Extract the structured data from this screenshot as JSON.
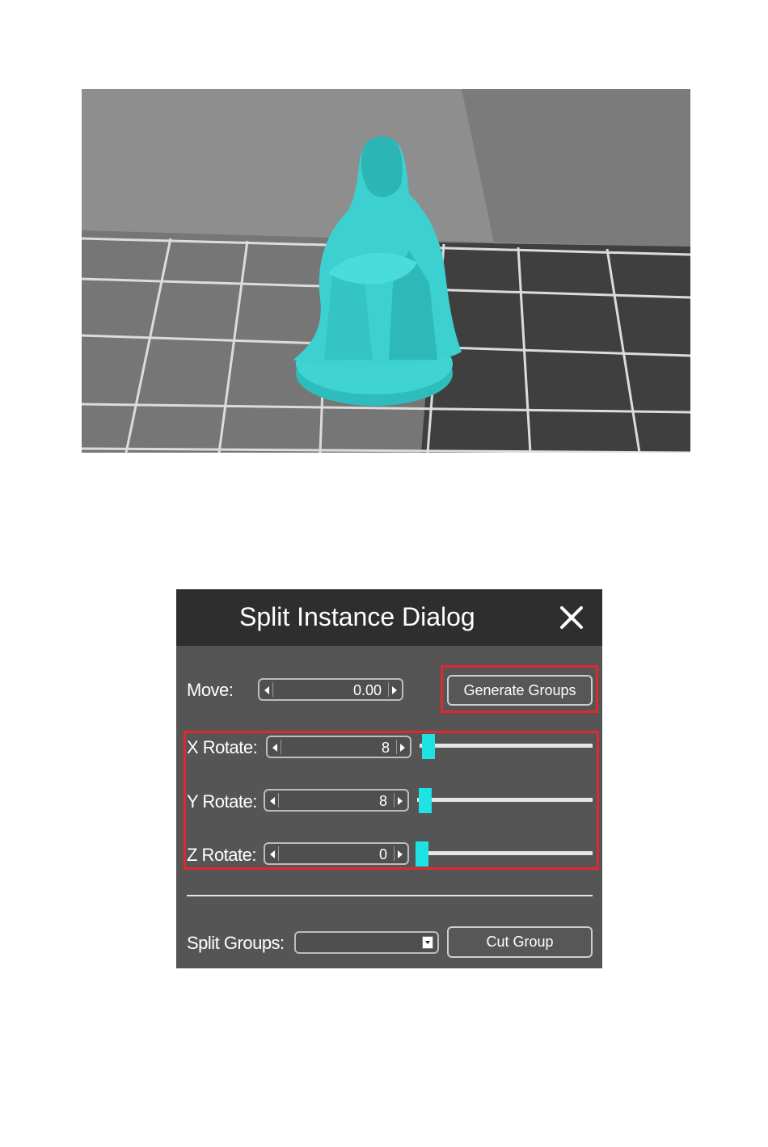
{
  "dialog": {
    "title": "Split Instance Dialog",
    "close_icon": "close-x-icon",
    "move": {
      "label": "Move:",
      "value": "0.00"
    },
    "generate_groups_label": "Generate Groups",
    "rotations": [
      {
        "label": "X Rotate:",
        "value": "8",
        "slider_fraction": 0.05
      },
      {
        "label": "Y Rotate:",
        "value": "8",
        "slider_fraction": 0.05
      },
      {
        "label": "Z Rotate:",
        "value": "0",
        "slider_fraction": 0.0
      }
    ],
    "split_groups": {
      "label": "Split Groups:",
      "selected": ""
    },
    "cut_group_label": "Cut Group",
    "colors": {
      "accent": "#1fe3e3",
      "highlight": "#e0282d",
      "title_bar": "#2e2e2e",
      "panel": "#555555"
    }
  },
  "viewport": {
    "model_color": "#33cccc",
    "grid_color": "#e0e0e0"
  }
}
